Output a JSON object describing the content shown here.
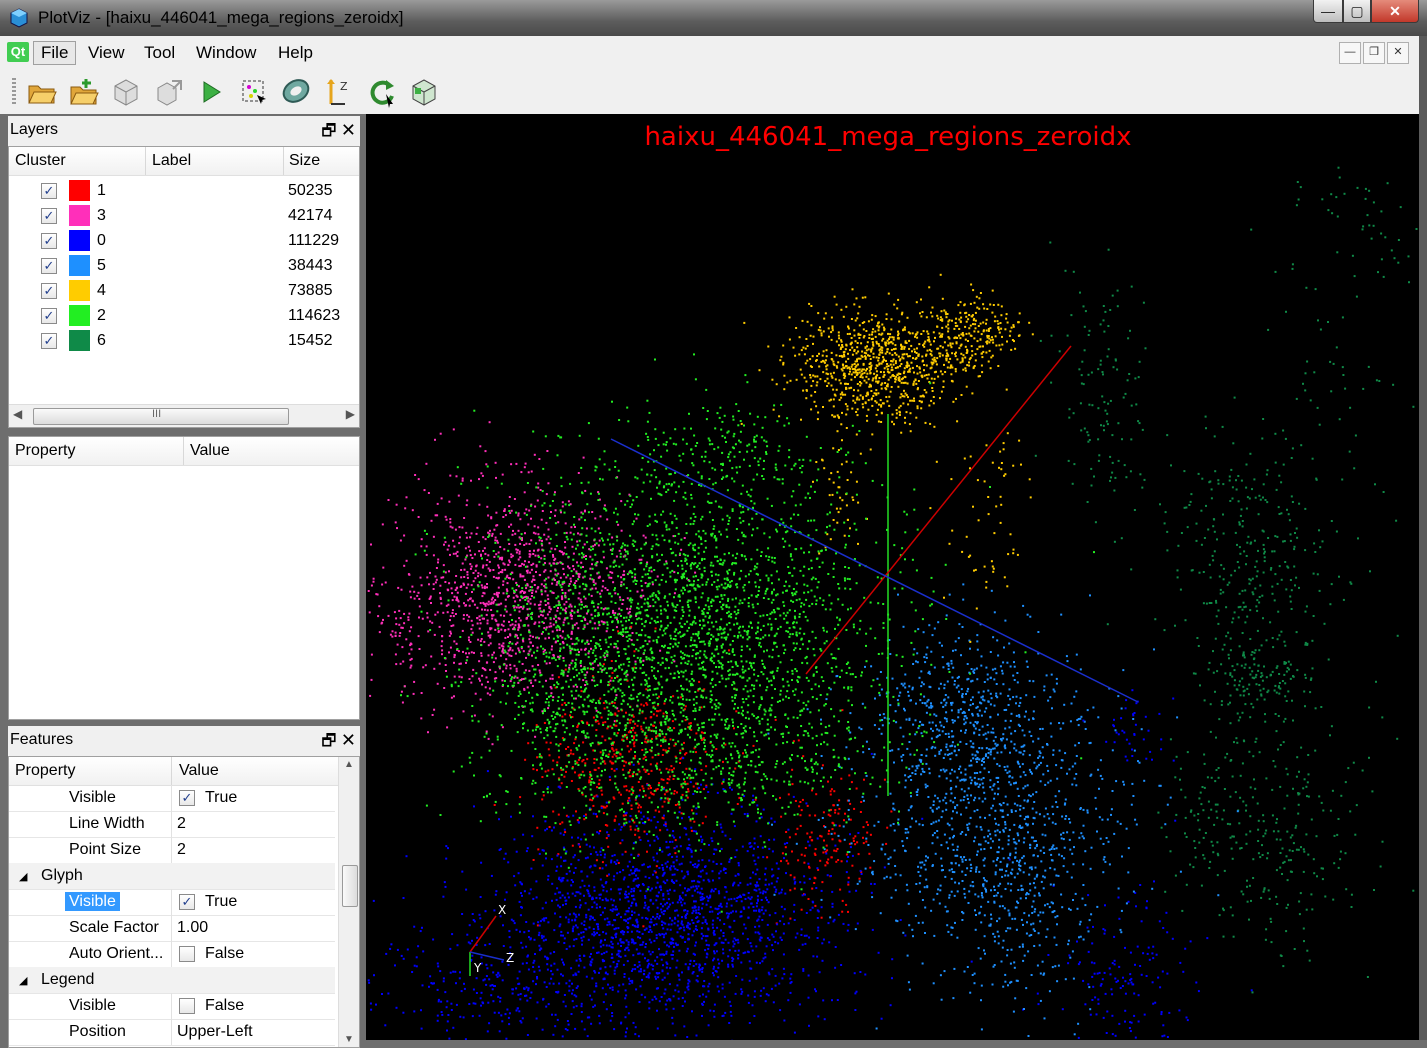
{
  "window": {
    "title": "PlotViz - [haixu_446041_mega_regions_zeroidx]",
    "buttons": {
      "minimize": "—",
      "maximize": "▢",
      "close": "✕"
    }
  },
  "menu": {
    "logo": "Qt",
    "items": [
      "File",
      "View",
      "Tool",
      "Window",
      "Help"
    ]
  },
  "toolbar": {
    "tools": [
      "open-folder",
      "open-add",
      "box-gray",
      "box-export",
      "play",
      "select-region",
      "lasso",
      "axes-xyz",
      "rotate-refresh",
      "box-cube"
    ]
  },
  "layers": {
    "title": "Layers",
    "columns": [
      "Cluster",
      "Label",
      "Size"
    ],
    "rows": [
      {
        "cluster": "1",
        "size": "50235",
        "color": "#ff0000",
        "checked": "✓"
      },
      {
        "cluster": "3",
        "size": "42174",
        "color": "#ff2fba",
        "checked": "✓"
      },
      {
        "cluster": "0",
        "size": "111229",
        "color": "#0000ff",
        "checked": "✓"
      },
      {
        "cluster": "5",
        "size": "38443",
        "color": "#1e90ff",
        "checked": "✓"
      },
      {
        "cluster": "4",
        "size": "73885",
        "color": "#ffcc00",
        "checked": "✓"
      },
      {
        "cluster": "2",
        "size": "114623",
        "color": "#22ee22",
        "checked": "✓"
      },
      {
        "cluster": "6",
        "size": "15452",
        "color": "#0f8a48",
        "checked": "✓"
      }
    ],
    "scroll_mark": "III"
  },
  "property_panel": {
    "columns": [
      "Property",
      "Value"
    ]
  },
  "features": {
    "title": "Features",
    "columns": [
      "Property",
      "Value"
    ],
    "rows": [
      {
        "name": "Visible",
        "value": "True",
        "check": "✓"
      },
      {
        "name": "Line Width",
        "value": "2"
      },
      {
        "name": "Point Size",
        "value": "2"
      },
      {
        "group": "Glyph"
      },
      {
        "name": "Visible",
        "value": "True",
        "check": "✓",
        "selected": true
      },
      {
        "name": "Scale Factor",
        "value": "1.00"
      },
      {
        "name": "Auto Orient...",
        "value": "False",
        "check": ""
      },
      {
        "group": "Legend"
      },
      {
        "name": "Visible",
        "value": "False",
        "check": ""
      },
      {
        "name": "Position",
        "value": "Upper-Left"
      }
    ]
  },
  "viewport": {
    "title": "haixu_446041_mega_regions_zeroidx",
    "title_color": "#ff0000",
    "axis_labels": {
      "x": "X",
      "y": "Y",
      "z": "Z"
    }
  }
}
